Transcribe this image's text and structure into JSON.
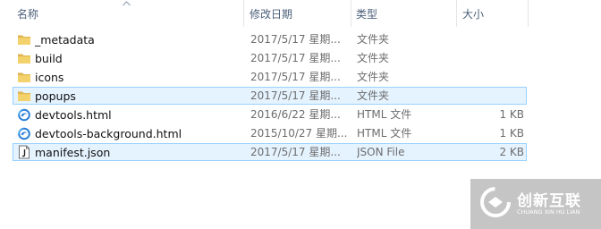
{
  "columns": {
    "name": "名称",
    "date": "修改日期",
    "type": "类型",
    "size": "大小"
  },
  "files": [
    {
      "name": "_metadata",
      "date": "2017/5/17 星期...",
      "type": "文件夹",
      "size": "",
      "icon": "folder-icon",
      "selected": false
    },
    {
      "name": "build",
      "date": "2017/5/17 星期...",
      "type": "文件夹",
      "size": "",
      "icon": "folder-icon",
      "selected": false
    },
    {
      "name": "icons",
      "date": "2017/5/17 星期...",
      "type": "文件夹",
      "size": "",
      "icon": "folder-icon",
      "selected": false
    },
    {
      "name": "popups",
      "date": "2017/5/17 星期...",
      "type": "文件夹",
      "size": "",
      "icon": "folder-icon",
      "selected": true
    },
    {
      "name": "devtools.html",
      "date": "2016/6/22 星期...",
      "type": "HTML 文件",
      "size": "1 KB",
      "icon": "html-file-icon",
      "selected": false
    },
    {
      "name": "devtools-background.html",
      "date": "2015/10/27 星期...",
      "type": "HTML 文件",
      "size": "1 KB",
      "icon": "html-file-icon",
      "selected": false
    },
    {
      "name": "manifest.json",
      "date": "2017/5/17 星期...",
      "type": "JSON File",
      "size": "2 KB",
      "icon": "json-file-icon",
      "selected": true
    }
  ],
  "watermark": {
    "title": "创新互联",
    "subtitle": "CHUANG XIN HU LIAN",
    "icon": "logo-icon"
  },
  "colors": {
    "selection_bg": "#e5f3ff",
    "selection_border": "#99d1ff",
    "header_text": "#4c607a",
    "folder": "#e8c45c"
  }
}
